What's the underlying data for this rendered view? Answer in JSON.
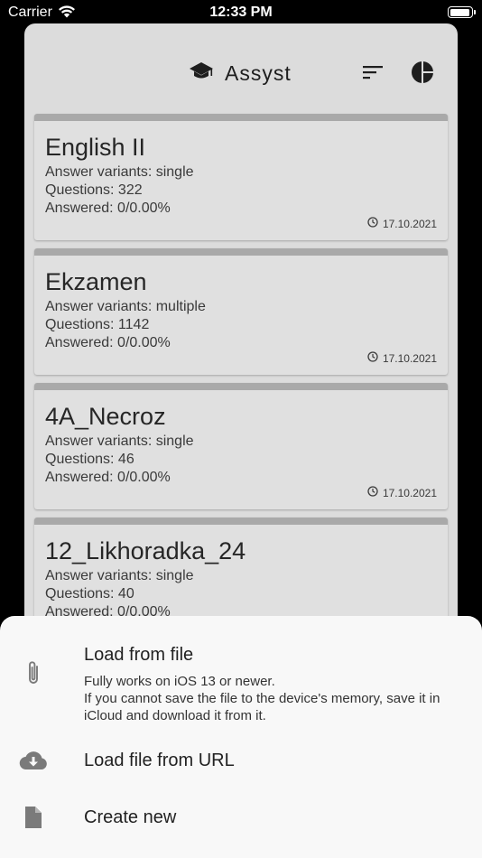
{
  "status_bar": {
    "carrier": "Carrier",
    "time": "12:33 PM",
    "battery_level": 0.95
  },
  "header": {
    "title": "Assyst",
    "icons": [
      "graduation-cap-icon",
      "sort-icon",
      "pie-chart-icon"
    ]
  },
  "tests": [
    {
      "name": "English II",
      "variants": "Answer variants: single",
      "questions": "Questions: 322",
      "answered": "Answered: 0/0.00%",
      "date": "17.10.2021"
    },
    {
      "name": "Ekzamen",
      "variants": "Answer variants: multiple",
      "questions": "Questions: 1142",
      "answered": "Answered: 0/0.00%",
      "date": "17.10.2021"
    },
    {
      "name": "4A_Necroz",
      "variants": "Answer variants: single",
      "questions": "Questions: 46",
      "answered": "Answered: 0/0.00%",
      "date": "17.10.2021"
    },
    {
      "name": "12_Likhoradka_24",
      "variants": "Answer variants: single",
      "questions": "Questions: 40",
      "answered": "Answered: 0/0.00%",
      "date": ""
    }
  ],
  "bottom_sheet": {
    "load_file": {
      "label": "Load from file",
      "desc1": "Fully works on iOS 13 or newer.",
      "desc2": "If you cannot save the file to the device's memory, save it in iCloud and download it from it.",
      "icon": "paperclip-icon"
    },
    "load_url": {
      "label": "Load file from URL",
      "icon": "cloud-download-icon"
    },
    "create_new": {
      "label": "Create new",
      "icon": "file-icon"
    }
  },
  "colors": {
    "card_bar": "#a9a9a9",
    "sheet_bg": "#dcdcdc",
    "card_bg": "#e0e0e0",
    "icon_gray": "#7a7a7a"
  }
}
